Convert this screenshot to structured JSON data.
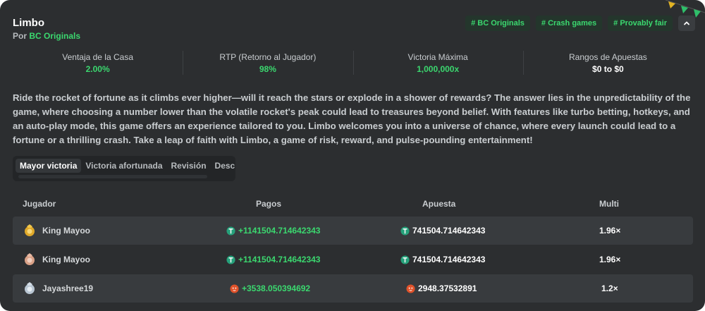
{
  "header": {
    "title": "Limbo",
    "by_prefix": "Por",
    "by_link": "BC Originals",
    "tags": [
      "# BC Originals",
      "# Crash games",
      "# Provably fair"
    ]
  },
  "stats": [
    {
      "label": "Ventaja de la Casa",
      "value": "2.00%"
    },
    {
      "label": "RTP (Retorno al Jugador)",
      "value": "98%"
    },
    {
      "label": "Victoria Máxima",
      "value": "1,000,000x"
    },
    {
      "label": "Rangos de Apuestas",
      "value": "$0 to $0"
    }
  ],
  "description": "Ride the rocket of fortune as it climbs ever higher—will it reach the stars or explode in a shower of rewards? The answer lies in the unpredictability of the game, where choosing a number lower than the volatile rocket's peak could lead to treasures beyond belief. With features like turbo betting, hotkeys, and an auto-play mode, this game offers an experience tailored to you. Limbo welcomes you into a universe of chance, where every launch could lead to a fortune or a thrilling crash. Take a leap of faith with Limbo, a game of risk, reward, and pulse-pounding entertainment!",
  "tabs": [
    "Mayor victoria",
    "Victoria afortunada",
    "Revisión",
    "Descrip"
  ],
  "table": {
    "headers": [
      "Jugador",
      "Pagos",
      "Apuesta",
      "Multi"
    ],
    "rows": [
      {
        "player": "King Mayoo",
        "payout": "+1141504.714642343",
        "bet": "741504.714642343",
        "multi": "1.96×",
        "coin": "tether",
        "avatar": "gold"
      },
      {
        "player": "King Mayoo",
        "payout": "+1141504.714642343",
        "bet": "741504.714642343",
        "multi": "1.96×",
        "coin": "tether",
        "avatar": "bronze"
      },
      {
        "player": "Jayashree19",
        "payout": "+3538.050394692",
        "bet": "2948.37532891",
        "multi": "1.2×",
        "coin": "shib",
        "avatar": "silver"
      }
    ]
  },
  "icons": {
    "collapse": "chevron-up-icon",
    "coin_tether": "tether-coin-icon",
    "coin_shib": "shib-coin-icon",
    "avatar": "medal-avatar-icon"
  },
  "colors": {
    "accent_green": "#3bd86f",
    "panel_bg": "#2c2e30",
    "row_alt_bg": "#383b3e",
    "tag_bg": "#24362c"
  }
}
